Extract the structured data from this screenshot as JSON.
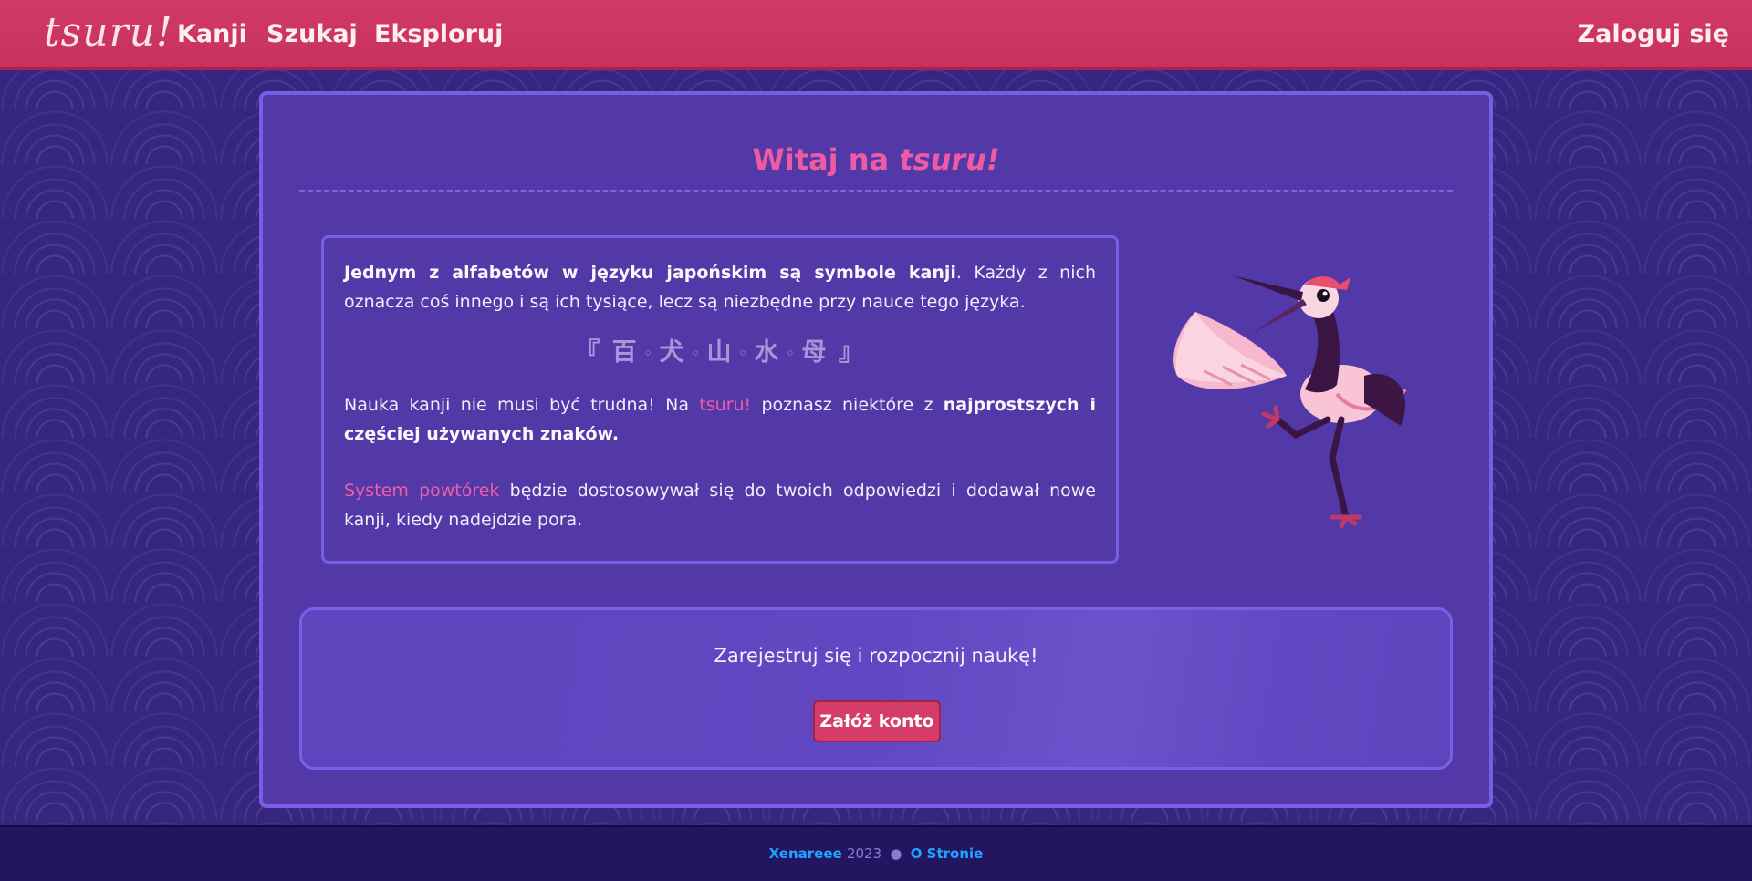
{
  "nav": {
    "logo": "tsuru!",
    "links": [
      "Kanji",
      "Szukaj",
      "Eksploruj"
    ],
    "login": "Zaloguj się"
  },
  "welcome": {
    "prefix": "Witaj na ",
    "brand": "tsuru!"
  },
  "info": {
    "p1_bold": "Jednym z alfabetów w języku japońskim są symbole ",
    "p1_kanji": "kanji",
    "p1_rest": ". Każdy z nich oznacza coś innego i są ich tysiące, lecz są niezbędne przy nauce tego języka.",
    "kanji_open": "『",
    "kanji": [
      "百",
      "犬",
      "山",
      "水",
      "母"
    ],
    "kanji_sep": "◦",
    "kanji_close": "』",
    "p2_start": "Nauka kanji nie musi być trudna! Na ",
    "p2_brand": "tsuru!",
    "p2_mid": " poznasz niektóre z ",
    "p2_bold": "najprostszych i częściej używanych znaków",
    "p2_end": ".",
    "p3_link": "System powtórek",
    "p3_rest": " będzie dostosowywał się do twoich odpowiedzi i dodawał nowe kanji, kiedy nadejdzie pora."
  },
  "signup": {
    "text": "Zarejestruj się i rozpocznij naukę!",
    "button": "Załóż konto"
  },
  "footer": {
    "author": "Xenareee",
    "year": "2023",
    "dot": "●",
    "about": "O Stronie"
  },
  "colors": {
    "nav": "#d13a68",
    "background": "#35267f",
    "card": "#5339a7",
    "accent_pink": "#ef5da8",
    "footer_link": "#1fa4ff"
  }
}
